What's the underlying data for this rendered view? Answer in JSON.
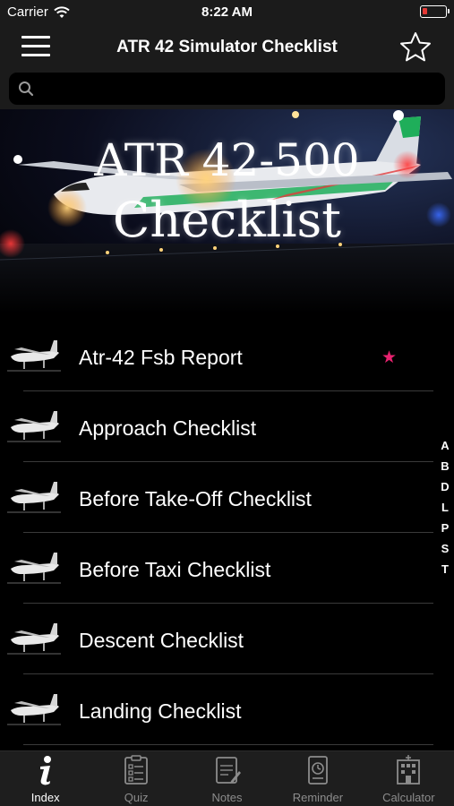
{
  "status_bar": {
    "carrier": "Carrier",
    "time": "8:22 AM"
  },
  "header": {
    "title": "ATR 42 Simulator Checklist"
  },
  "search": {
    "placeholder": ""
  },
  "banner": {
    "line1": "ATR 42-500",
    "line2": "Checklist"
  },
  "list": {
    "items": [
      {
        "label": "Atr-42 Fsb Report",
        "favorite": true
      },
      {
        "label": "Approach Checklist",
        "favorite": false
      },
      {
        "label": "Before Take-Off Checklist",
        "favorite": false
      },
      {
        "label": "Before Taxi Checklist",
        "favorite": false
      },
      {
        "label": "Descent Checklist",
        "favorite": false
      },
      {
        "label": "Landing Checklist",
        "favorite": false
      }
    ],
    "favorite_icon": "★"
  },
  "index_letters": [
    "A",
    "B",
    "D",
    "L",
    "P",
    "S",
    "T"
  ],
  "tabbar": {
    "tabs": [
      {
        "label": "Index",
        "icon": "info-icon",
        "active": true
      },
      {
        "label": "Quiz",
        "icon": "quiz-icon",
        "active": false
      },
      {
        "label": "Notes",
        "icon": "notes-icon",
        "active": false
      },
      {
        "label": "Reminder",
        "icon": "reminder-icon",
        "active": false
      },
      {
        "label": "Calculator",
        "icon": "calculator-icon",
        "active": false
      }
    ]
  },
  "colors": {
    "bar_background": "#1b1b1b",
    "favorite_star": "#e8226f",
    "battery_low": "#e53935"
  }
}
